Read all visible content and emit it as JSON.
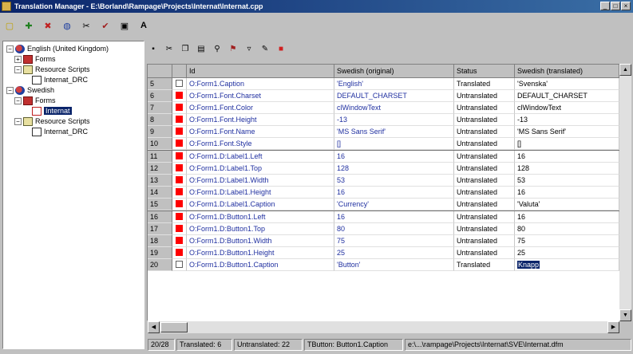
{
  "window": {
    "title": "Translation Manager - E:\\Borland\\Rampage\\Projects\\Internat\\Internat.cpp",
    "controls": [
      "_",
      "□",
      "×"
    ]
  },
  "toolbar": {
    "icons": [
      "new-icon",
      "add-lang-icon",
      "remove-lang-icon",
      "web-icon",
      "sep",
      "cut-icon",
      "check-icon",
      "refresh-icon",
      "font-icon"
    ]
  },
  "tree": {
    "nodes": [
      {
        "label": "English (United Kingdom)",
        "icon": "globe-icon",
        "exp": "−"
      },
      {
        "label": "Forms",
        "icon": "forms-icon",
        "exp": "+"
      },
      {
        "label": "Resource Scripts",
        "icon": "script-icon",
        "exp": "−"
      },
      {
        "label": "Internat_DRC",
        "icon": "doc-icon",
        "exp": ""
      },
      {
        "label": "Swedish",
        "icon": "globe-icon",
        "exp": "−"
      },
      {
        "label": "Forms",
        "icon": "forms-icon",
        "exp": "−"
      },
      {
        "label": "Internat",
        "icon": "form-icon",
        "exp": "",
        "selected": true
      },
      {
        "label": "Resource Scripts",
        "icon": "script-icon",
        "exp": "−"
      },
      {
        "label": "Internat_DRC",
        "icon": "doc-icon",
        "exp": ""
      }
    ]
  },
  "grid": {
    "columns": [
      "",
      "",
      "Id",
      "Swedish (original)",
      "Status",
      "Swedish (translated)"
    ],
    "rows": [
      {
        "n": "5",
        "mark": "white",
        "id": "O:Form1.Caption",
        "orig": "'English'",
        "status": "Translated",
        "trans": "'Svenska'"
      },
      {
        "n": "6",
        "mark": "red",
        "id": "O:Form1.Font.Charset",
        "orig": "DEFAULT_CHARSET",
        "status": "Untranslated",
        "trans": "DEFAULT_CHARSET"
      },
      {
        "n": "7",
        "mark": "red",
        "id": "O:Form1.Font.Color",
        "orig": "clWindowText",
        "status": "Untranslated",
        "trans": "clWindowText"
      },
      {
        "n": "8",
        "mark": "red",
        "id": "O:Form1.Font.Height",
        "orig": "-13",
        "status": "Untranslated",
        "trans": "-13"
      },
      {
        "n": "9",
        "mark": "red",
        "id": "O:Form1.Font.Name",
        "orig": "'MS Sans Serif'",
        "status": "Untranslated",
        "trans": "'MS Sans Serif'"
      },
      {
        "n": "10",
        "mark": "red",
        "id": "O:Form1.Font.Style",
        "orig": "[]",
        "status": "Untranslated",
        "trans": "[]",
        "grp": true
      },
      {
        "n": "11",
        "mark": "red",
        "id": "O:Form1.D:Label1.Left",
        "orig": "16",
        "status": "Untranslated",
        "trans": "16"
      },
      {
        "n": "12",
        "mark": "red",
        "id": "O:Form1.D:Label1.Top",
        "orig": "128",
        "status": "Untranslated",
        "trans": "128"
      },
      {
        "n": "13",
        "mark": "red",
        "id": "O:Form1.D:Label1.Width",
        "orig": "53",
        "status": "Untranslated",
        "trans": "53"
      },
      {
        "n": "14",
        "mark": "red",
        "id": "O:Form1.D:Label1.Height",
        "orig": "16",
        "status": "Untranslated",
        "trans": "16"
      },
      {
        "n": "15",
        "mark": "red",
        "id": "O:Form1.D:Label1.Caption",
        "orig": "'Currency'",
        "status": "Untranslated",
        "trans": "'Valuta'",
        "grp": true
      },
      {
        "n": "16",
        "mark": "red",
        "id": "O:Form1.D:Button1.Left",
        "orig": "16",
        "status": "Untranslated",
        "trans": "16"
      },
      {
        "n": "17",
        "mark": "red",
        "id": "O:Form1.D:Button1.Top",
        "orig": "80",
        "status": "Untranslated",
        "trans": "80"
      },
      {
        "n": "18",
        "mark": "red",
        "id": "O:Form1.D:Button1.Width",
        "orig": "75",
        "status": "Untranslated",
        "trans": "75"
      },
      {
        "n": "19",
        "mark": "red",
        "id": "O:Form1.D:Button1.Height",
        "orig": "25",
        "status": "Untranslated",
        "trans": "25"
      },
      {
        "n": "20",
        "mark": "white",
        "id": "O:Form1.D:Button1.Caption",
        "orig": "'Button'",
        "status": "Translated",
        "trans": "Knapp",
        "highlight": true
      }
    ]
  },
  "statusbar": {
    "position": "20/28",
    "translated": "Translated: 6",
    "untranslated": "Untranslated: 22",
    "item": "TButton: Button1.Caption",
    "path": "e:\\...\\rampage\\Projects\\Internat\\SVE\\Internat.dfm"
  },
  "colors": {
    "titlebar": "#0a246a",
    "accent": "#2030a0",
    "untranslated_mark": "#ff0000"
  }
}
